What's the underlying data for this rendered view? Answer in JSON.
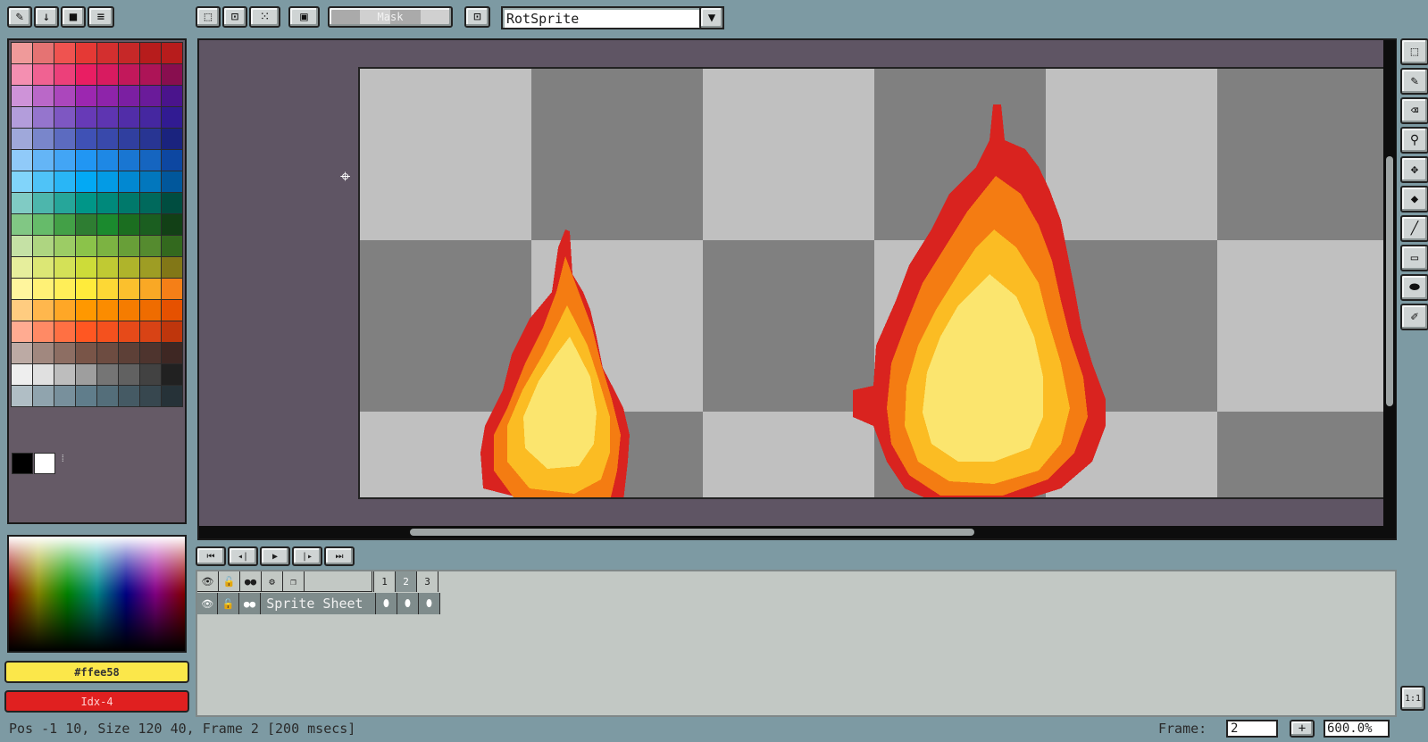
{
  "toolbar": {
    "left_icons": [
      "pencil-icon",
      "download-icon",
      "square-icon",
      "menu-icon"
    ],
    "selection_icons": [
      "marquee-icon",
      "select-center-icon",
      "select-dots-icon"
    ],
    "mask_label": "Mask",
    "rotation_algorithm": "RotSprite"
  },
  "colors": {
    "fg_hex": "#ffee58",
    "bg_index": "Idx-4",
    "fg_color": "#fbe74a",
    "bg_color": "#e02020"
  },
  "palette": [
    [
      "#ef9a9a",
      "#e57373",
      "#ef5350",
      "#e53935",
      "#d32f2f",
      "#c62828",
      "#b71c1c",
      "#b71c1c"
    ],
    [
      "#f48fb1",
      "#f06292",
      "#ec407a",
      "#e91e63",
      "#d81b60",
      "#c2185b",
      "#ad1457",
      "#880e4f"
    ],
    [
      "#ce93d8",
      "#ba68c8",
      "#ab47bc",
      "#9c27b0",
      "#8e24aa",
      "#7b1fa2",
      "#6a1b9a",
      "#4a148c"
    ],
    [
      "#b39ddb",
      "#9575cd",
      "#7e57c2",
      "#673ab7",
      "#5e35b1",
      "#512da8",
      "#4527a0",
      "#311b92"
    ],
    [
      "#9fa8da",
      "#7986cb",
      "#5c6bc0",
      "#3f51b5",
      "#3949ab",
      "#303f9f",
      "#283593",
      "#1a237e"
    ],
    [
      "#90caf9",
      "#64b5f6",
      "#42a5f5",
      "#2196f3",
      "#1e88e5",
      "#1976d2",
      "#1565c0",
      "#0d47a1"
    ],
    [
      "#81d4fa",
      "#4fc3f7",
      "#29b6f6",
      "#03a9f4",
      "#039be5",
      "#0288d1",
      "#0277bd",
      "#01579b"
    ],
    [
      "#80cbc4",
      "#4db6ac",
      "#26a69a",
      "#009688",
      "#00897b",
      "#00796b",
      "#00695c",
      "#004d40"
    ],
    [
      "#81c784",
      "#66bb6a",
      "#43a047",
      "#2e7d32",
      "#1b8a2e",
      "#1b6e20",
      "#1b5e20",
      "#124016"
    ],
    [
      "#c5e1a5",
      "#aed581",
      "#9ccc65",
      "#8bc34a",
      "#7cb342",
      "#689f38",
      "#558b2f",
      "#33691e"
    ],
    [
      "#e6ee9c",
      "#dce775",
      "#d4e157",
      "#cddc39",
      "#c0ca33",
      "#afb42b",
      "#9e9d24",
      "#827717"
    ],
    [
      "#fff59d",
      "#fff176",
      "#ffee58",
      "#ffeb3b",
      "#fdd835",
      "#fbc02d",
      "#f9a825",
      "#f57f17"
    ],
    [
      "#ffcc80",
      "#ffb74d",
      "#ffa726",
      "#ff9800",
      "#fb8c00",
      "#f57c00",
      "#ef6c00",
      "#e65100"
    ],
    [
      "#ffab91",
      "#ff8a65",
      "#ff7043",
      "#ff5722",
      "#f4511e",
      "#e64a19",
      "#d84315",
      "#bf360c"
    ],
    [
      "#bcaaa4",
      "#a1887f",
      "#8d6e63",
      "#795548",
      "#6d4c41",
      "#5d4037",
      "#4e342e",
      "#3e2723"
    ],
    [
      "#eeeeee",
      "#e0e0e0",
      "#bdbdbd",
      "#9e9e9e",
      "#757575",
      "#616161",
      "#424242",
      "#212121"
    ],
    [
      "#b0bec5",
      "#90a4ae",
      "#78909c",
      "#607d8b",
      "#546e7a",
      "#455a64",
      "#37474f",
      "#263238"
    ]
  ],
  "palette_extra": [
    "#000000",
    "#ffffff"
  ],
  "tools": [
    "marquee-tool-icon",
    "pencil-tool-icon",
    "eraser-tool-icon",
    "eyedropper-tool-icon",
    "move-tool-icon",
    "fill-tool-icon",
    "line-tool-icon",
    "rectangle-tool-icon",
    "ellipse-tool-icon",
    "spray-tool-icon"
  ],
  "timeline": {
    "nav_icons": [
      "first-frame-icon",
      "prev-frame-icon",
      "play-icon",
      "next-frame-icon",
      "last-frame-icon"
    ],
    "header_icons": [
      "eye-icon",
      "lock-icon",
      "link-icon",
      "gear-icon",
      "layers-icon"
    ],
    "frames": [
      "1",
      "2",
      "3"
    ],
    "layer_name": "Sprite Sheet"
  },
  "status": {
    "text": "Pos -1 10, Size 120 40, Frame 2 [200 msecs]",
    "frame_label": "Frame:",
    "frame_value": "2",
    "add_label": "+",
    "zoom": "600.0%",
    "ratio_label": "1:1"
  }
}
